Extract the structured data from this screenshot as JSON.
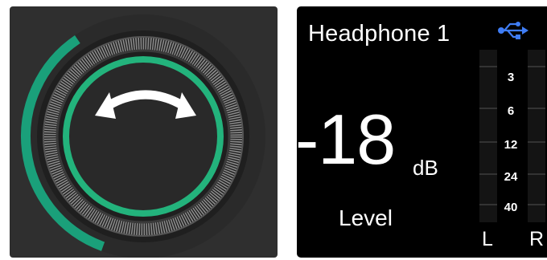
{
  "knob": {
    "arc_color": "#1aa07a",
    "ring_color": "#23b37c",
    "arrow_icon": "double-headed-curved-arrow",
    "level_fraction": 0.35
  },
  "display": {
    "title": "Headphone 1",
    "usb_icon": "usb-icon",
    "usb_color": "#3f7df5",
    "db_value": "-18",
    "db_unit": "dB",
    "level_label": "Level",
    "meter_scale": [
      "3",
      "6",
      "12",
      "24",
      "40"
    ],
    "left_channel": "L",
    "right_channel": "R"
  }
}
